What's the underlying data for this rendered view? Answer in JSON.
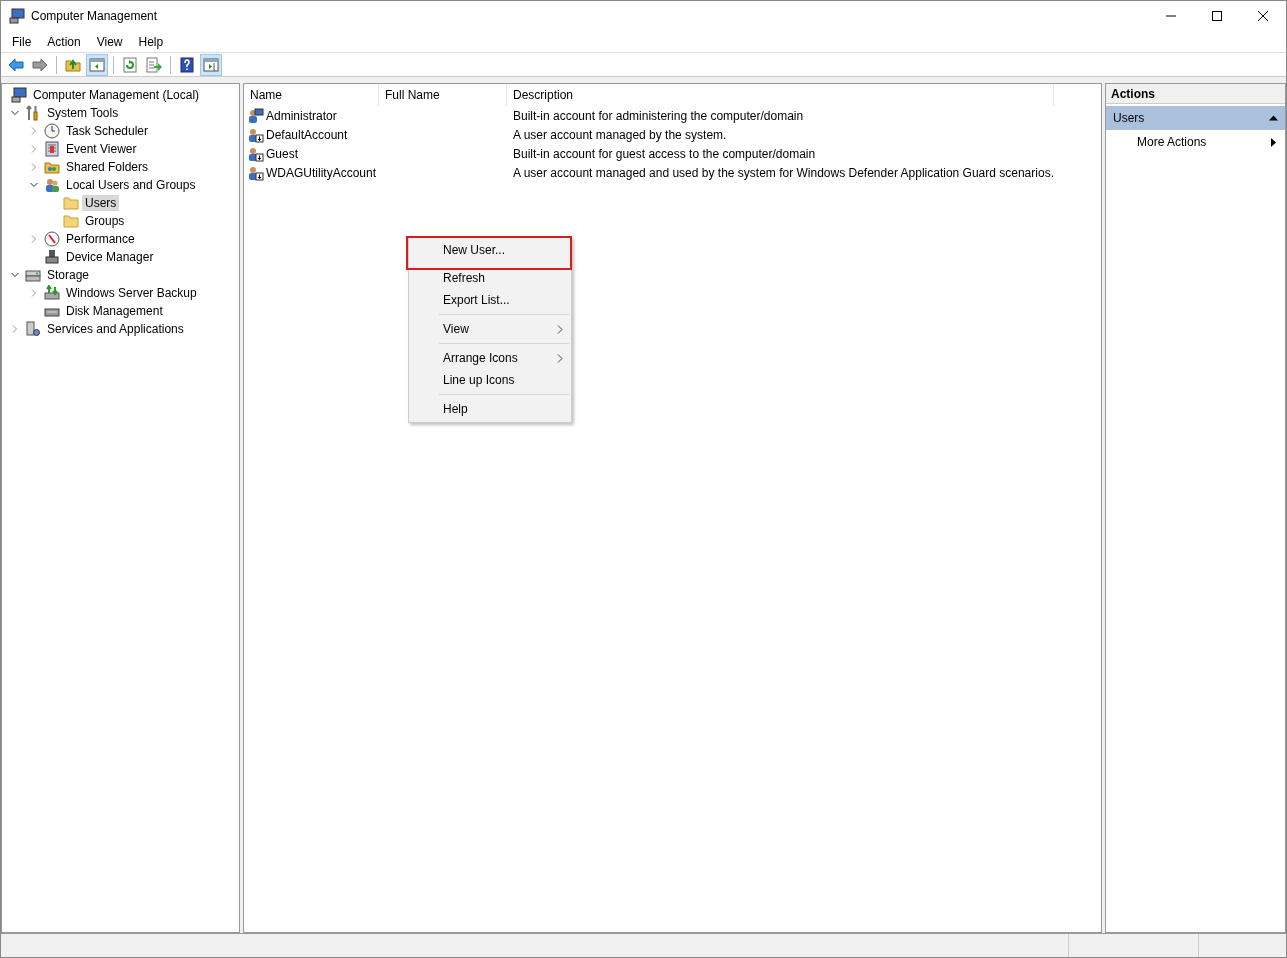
{
  "window": {
    "title": "Computer Management"
  },
  "menu_bar": [
    "File",
    "Action",
    "View",
    "Help"
  ],
  "toolbar": [
    {
      "buttons": [
        {
          "kind": "back",
          "pressed": false
        },
        {
          "kind": "forward",
          "pressed": false
        }
      ]
    },
    {
      "buttons": [
        {
          "kind": "up",
          "pressed": false
        },
        {
          "kind": "tree",
          "pressed": true
        }
      ]
    },
    {
      "buttons": [
        {
          "kind": "refresh",
          "pressed": false
        },
        {
          "kind": "export",
          "pressed": false
        }
      ]
    },
    {
      "buttons": [
        {
          "kind": "help",
          "pressed": false
        },
        {
          "kind": "pane",
          "pressed": true
        }
      ]
    }
  ],
  "tree": [
    {
      "label": "Computer Management (Local)",
      "selected": false,
      "children": [
        {
          "label": "System Tools",
          "selected": false,
          "expanded": true,
          "children": [
            {
              "label": "Task Scheduler",
              "selected": false,
              "expanded": false
            },
            {
              "label": "Event Viewer",
              "selected": false,
              "expanded": false
            },
            {
              "label": "Shared Folders",
              "selected": false,
              "expanded": false
            },
            {
              "label": "Local Users and Groups",
              "selected": false,
              "expanded": true,
              "children": [
                {
                  "label": "Users",
                  "selected": true
                },
                {
                  "label": "Groups",
                  "selected": false
                }
              ]
            },
            {
              "label": "Performance",
              "selected": false,
              "expanded": false
            },
            {
              "label": "Device Manager",
              "selected": false
            }
          ]
        },
        {
          "label": "Storage",
          "selected": false,
          "expanded": true,
          "children": [
            {
              "label": "Windows Server Backup",
              "selected": false,
              "expanded": false
            },
            {
              "label": "Disk Management",
              "selected": false
            }
          ]
        },
        {
          "label": "Services and Applications",
          "selected": false,
          "expanded": false
        }
      ]
    }
  ],
  "table": {
    "columns": [
      "Name",
      "Full Name",
      "Description"
    ],
    "rows": [
      {
        "name": "Administrator",
        "description": "Built-in account for administering the computer/domain",
        "disabled": false
      },
      {
        "name": "DefaultAccount",
        "description": "A user account managed by the system.",
        "disabled": true
      },
      {
        "name": "Guest",
        "description": "Built-in account for guest access to the computer/domain",
        "disabled": true
      },
      {
        "name": "WDAGUtilityAccount",
        "description": "A user account managed and used by the system for Windows Defender Application Guard scenarios.",
        "disabled": true
      }
    ]
  },
  "context_menu": [
    {
      "kind": "item",
      "label": "New User...",
      "submenu": false,
      "annotated": true
    },
    {
      "kind": "item",
      "label": "Refresh",
      "submenu": false,
      "annotated": false
    },
    {
      "kind": "item",
      "label": "Export List...",
      "submenu": false,
      "annotated": false
    },
    {
      "kind": "separator"
    },
    {
      "kind": "item",
      "label": "View",
      "submenu": true,
      "annotated": false
    },
    {
      "kind": "separator"
    },
    {
      "kind": "item",
      "label": "Arrange Icons",
      "submenu": true,
      "annotated": false
    },
    {
      "kind": "item",
      "label": "Line up Icons",
      "submenu": false,
      "annotated": false
    },
    {
      "kind": "separator"
    },
    {
      "kind": "item",
      "label": "Help",
      "submenu": false,
      "annotated": false
    }
  ],
  "actions": {
    "title": "Actions",
    "sections": [
      {
        "title": "Users",
        "expanded": true,
        "items": [
          {
            "label": "More Actions",
            "submenu": true
          }
        ]
      }
    ]
  }
}
